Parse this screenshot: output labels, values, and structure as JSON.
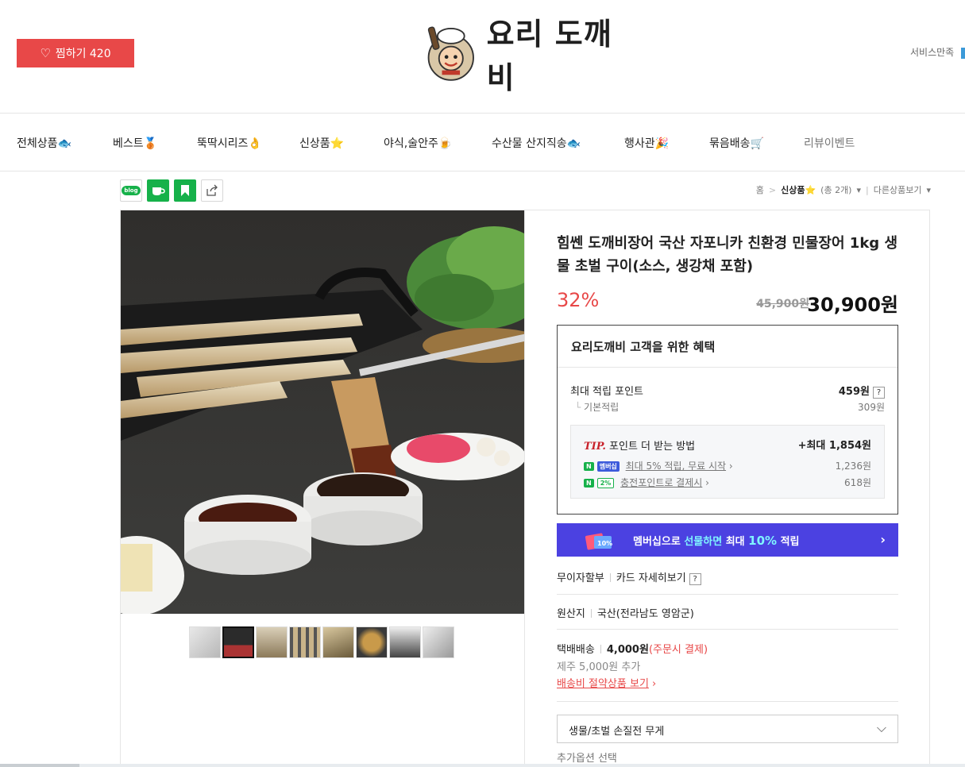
{
  "header": {
    "zzim_label": "찜하기 420",
    "logo_text": "요리 도깨비",
    "service_label": "서비스만족"
  },
  "gnb": {
    "items": [
      {
        "label": "전체상품",
        "icon": "🐟"
      },
      {
        "label": "베스트",
        "icon": "🥉"
      },
      {
        "label": "뚝딱시리즈",
        "icon": "👌"
      },
      {
        "label": "신상품",
        "icon": "⭐"
      },
      {
        "label": "야식,술안주",
        "icon": "🍺"
      },
      {
        "label": "수산물 산지직송",
        "icon": "🐟"
      },
      {
        "label": "행사관",
        "icon": "🎉"
      },
      {
        "label": "묶음배송",
        "icon": "🛒"
      },
      {
        "label": "리뷰이벤트",
        "icon": ""
      }
    ]
  },
  "toolbar": {
    "blog_label": "blog",
    "icons": [
      "blog-icon",
      "cafe-icon",
      "keep-icon",
      "share-icon"
    ]
  },
  "breadcrumb": {
    "home": "홈",
    "sep": ">",
    "current": "신상품⭐",
    "count": "(총 2개)",
    "other": "다른상품보기"
  },
  "product": {
    "title": "힘쎈 도깨비장어 국산 자포니카 친환경 민물장어 1kg 생물 초벌 구이(소스, 생강채 포함)",
    "discount": "32%",
    "original_price": "45,900원",
    "sale_price": "30,900원",
    "thumbnail_count": 8,
    "active_thumbnail": 2
  },
  "benefit": {
    "heading": "요리도깨비 고객을 위한 혜택",
    "max_point_label": "최대 적립 포인트",
    "max_point_value": "459원",
    "base_label": "기본적립",
    "base_value": "309원",
    "tip_label": "TIP.",
    "tip_text": "포인트 더 받는 방법",
    "tip_max": "+최대 1,854원",
    "line1_badge": "멤버십",
    "line1_text": "최대 5% 적립, 무료 시작",
    "line1_value": "1,236원",
    "line2_badge": "2%",
    "line2_text": "충전포인트로 결제시",
    "line2_value": "618원"
  },
  "banner": {
    "text_a": "멤버십으로 ",
    "text_b": "선물하면",
    "text_c": " 최대 ",
    "text_d": "10%",
    "text_e": " 적립"
  },
  "card": {
    "label": "무이자할부",
    "detail": "카드 자세히보기"
  },
  "origin": {
    "label": "원산지",
    "value": "국산(전라남도 영암군)"
  },
  "shipping": {
    "label": "택배배송",
    "fee": "4,000원",
    "note": "(주문시 결제)",
    "extra": "제주 5,000원 추가",
    "link": "배송비 절약상품 보기"
  },
  "option": {
    "select_label": "생물/초벌 손질전 무게",
    "add_label": "추가옵션 선택"
  },
  "colors": {
    "accent_red": "#e84848",
    "naver_green": "#16b14a",
    "banner_purple": "#4b41e1"
  }
}
